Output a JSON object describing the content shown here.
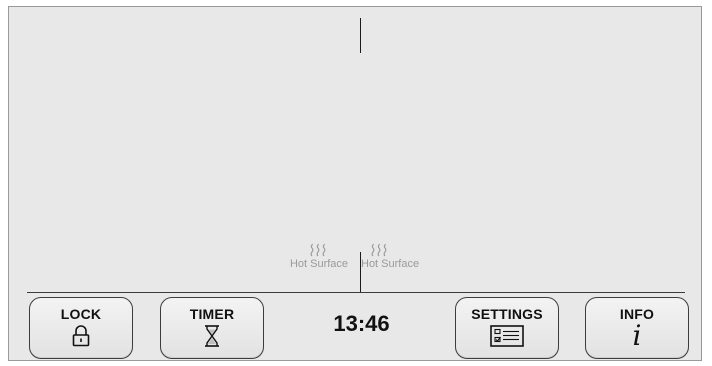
{
  "zones": {
    "left": {
      "status_label": "Hot Surface",
      "status_icon": "heat-waves-icon"
    },
    "right": {
      "status_label": "Hot Surface",
      "status_icon": "heat-waves-icon"
    }
  },
  "controls": {
    "lock": {
      "label": "LOCK",
      "icon": "padlock-icon"
    },
    "timer": {
      "label": "TIMER",
      "icon": "hourglass-icon"
    },
    "clock": "13:46",
    "settings": {
      "label": "SETTINGS",
      "icon": "settings-checklist-icon"
    },
    "info": {
      "label": "INFO",
      "icon": "info-icon",
      "glyph": "i"
    }
  },
  "colors": {
    "panel_background": "#e8e8e8",
    "hot_surface_text": "#9a9a9a",
    "button_border": "#3c3c3c"
  }
}
